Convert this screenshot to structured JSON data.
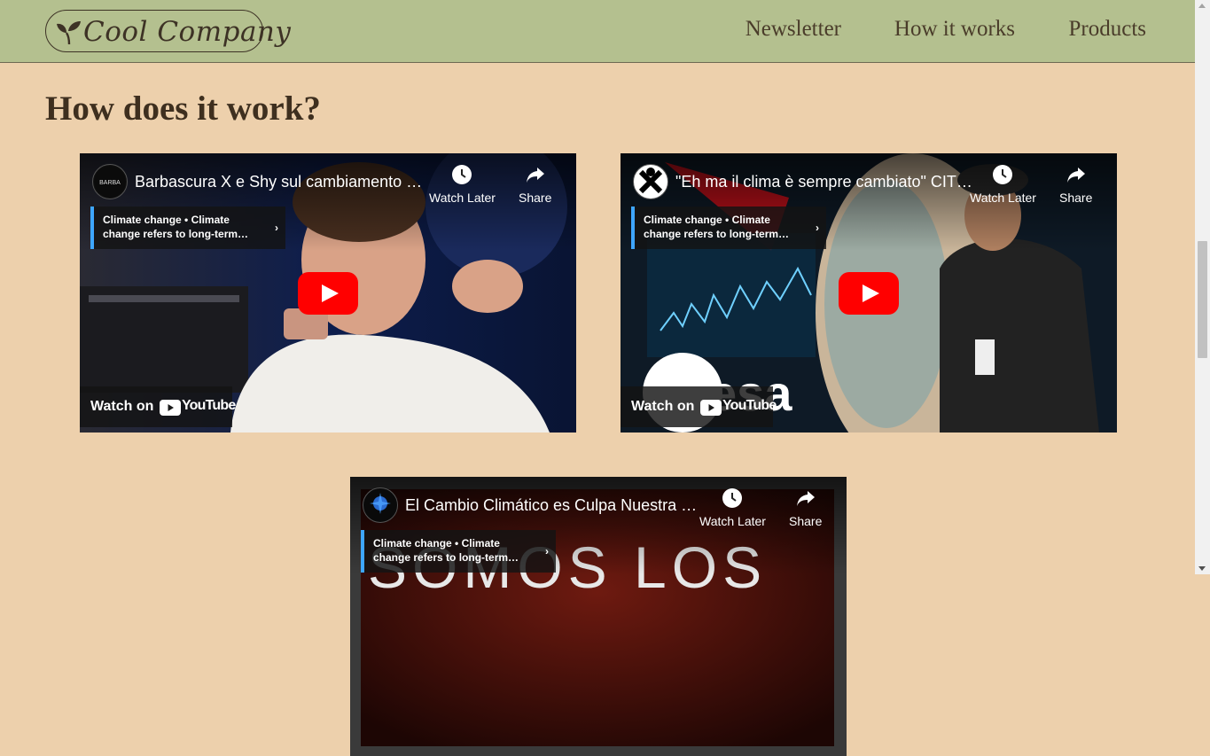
{
  "header": {
    "logo_text": "Cool Company",
    "nav_links": [
      "Newsletter",
      "How it works",
      "Products"
    ]
  },
  "main": {
    "heading": "How does it work?"
  },
  "videos": [
    {
      "title": "Barbascura X e Shy sul cambiamento …",
      "card_line1": "Climate change • Climate",
      "card_line2": "change refers to long-term…",
      "watch_later": "Watch Later",
      "share": "Share",
      "watch_on": "Watch on",
      "platform": "YouTube"
    },
    {
      "title": "\"Eh ma il clima è sempre cambiato\" CIT…",
      "card_line1": "Climate change • Climate",
      "card_line2": "change refers to long-term…",
      "watch_later": "Watch Later",
      "share": "Share",
      "watch_on": "Watch on",
      "platform": "YouTube",
      "overlay_logo": "esa"
    },
    {
      "title": "El Cambio Climático es Culpa Nuestra …",
      "card_line1": "Climate change • Climate",
      "card_line2": "change refers to long-term…",
      "watch_later": "Watch Later",
      "share": "Share",
      "overlay_text": "SOMOS LOS"
    }
  ],
  "colors": {
    "header_bg": "#b4c08f",
    "page_bg": "#edd0ac",
    "text_dark": "#3e2f1f",
    "youtube_red": "#ff0000",
    "card_accent": "#3ea6ff"
  },
  "icons": [
    "sprout-icon",
    "clock-icon",
    "share-arrow-icon",
    "play-button-icon",
    "youtube-logo-icon",
    "chevron-right-icon"
  ]
}
